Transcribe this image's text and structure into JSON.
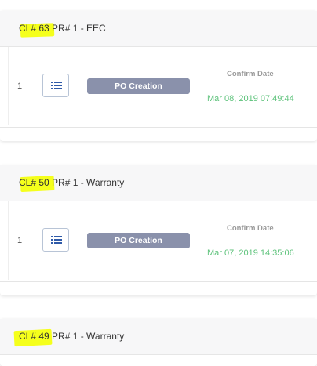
{
  "cards": [
    {
      "cl_label": "CL# 63",
      "pr_label": " PR# 1 - EEC",
      "row_number": "1",
      "status": "PO Creation",
      "confirm_label": "Confirm Date",
      "confirm_date": "Mar 08, 2019 07:49:44"
    },
    {
      "cl_label": "CL# 50",
      "pr_label": " PR# 1 - Warranty",
      "row_number": "1",
      "status": "PO Creation",
      "confirm_label": "Confirm Date",
      "confirm_date": "Mar 07, 2019 14:35:06"
    },
    {
      "cl_label": "CL# 49",
      "pr_label": " PR# 1 - Warranty"
    }
  ],
  "colors": {
    "highlight": "#f5ff1c",
    "status_badge": "#8a91ab",
    "confirm_date": "#5cc27a",
    "list_icon": "#2f5aa8"
  },
  "icons": {
    "list_button": "list-icon"
  }
}
